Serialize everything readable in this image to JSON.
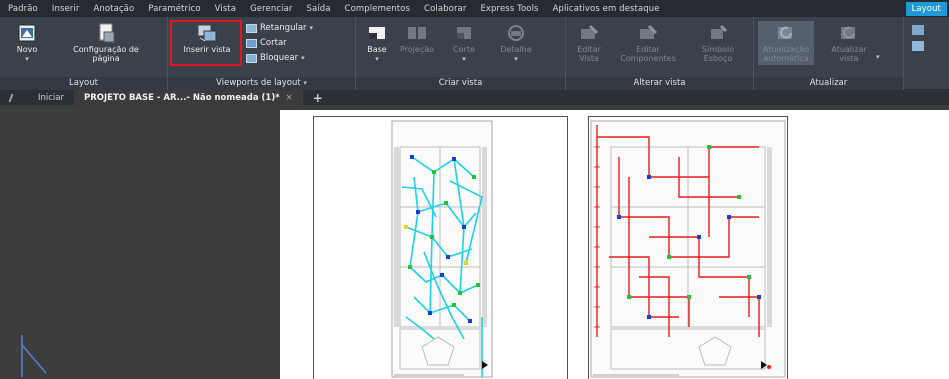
{
  "menu_tabs": [
    "Padrão",
    "Inserir",
    "Anotação",
    "Paramétrico",
    "Vista",
    "Gerenciar",
    "Saída",
    "Complementos",
    "Colaborar",
    "Express Tools",
    "Aplicativos em destaque",
    "Layout"
  ],
  "ribbon": {
    "layout_group": {
      "label": "Layout",
      "novo": "Novo",
      "config_line1": "Configuração de",
      "config_line2": "página"
    },
    "viewports_group": {
      "label": "Viewports de layout",
      "inserir_vista": "Inserir vista",
      "retangular": "Retangular",
      "cortar": "Cortar",
      "bloquear": "Bloquear"
    },
    "criar_vista_group": {
      "label": "Criar vista",
      "base": "Base",
      "projecao": "Projeção",
      "corte": "Corte",
      "detalhe": "Detalhe"
    },
    "alterar_vista_group": {
      "label": "Alterar vista",
      "editar_vista_1": "Editar",
      "editar_vista_2": "Vista",
      "editar_comp_1": "Editar",
      "editar_comp_2": "Componentes",
      "simbolo_1": "Símbolo",
      "simbolo_2": "Esboço"
    },
    "atualizar_group": {
      "label": "Atualizar",
      "auto_1": "Atualização",
      "auto_2": "automática",
      "atualizar_1": "Atualizar",
      "atualizar_2": "vista"
    }
  },
  "file_tabs": {
    "start": "Iniciar",
    "document": "PROJETO BASE - AR...- Não nomeada (1)*",
    "close": "×",
    "add": "+"
  },
  "colors": {
    "accent": "#1e9bd7",
    "highlight": "#e0171d",
    "cyan_wiring": "#19d4e6",
    "red_wiring": "#e81c1c"
  }
}
